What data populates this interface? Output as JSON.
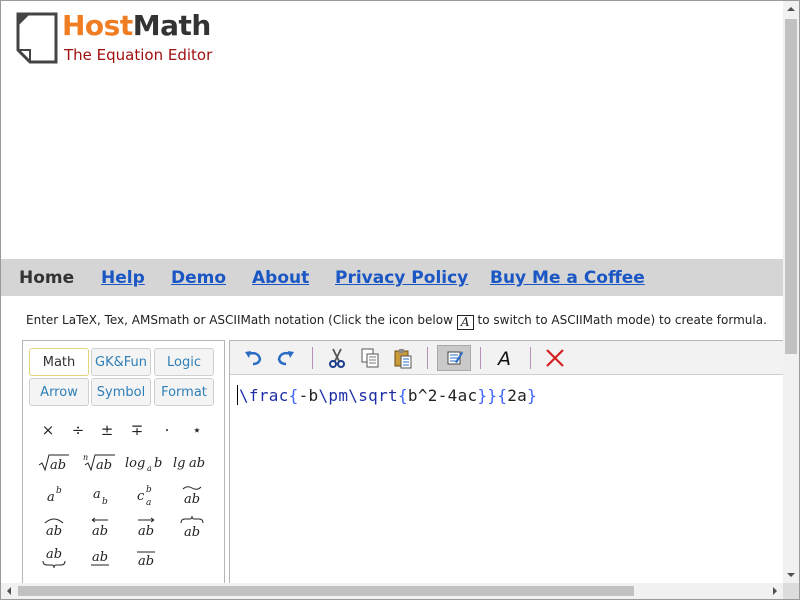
{
  "header": {
    "brand_part1": "Host",
    "brand_part2": "Math",
    "tagline": "The Equation Editor"
  },
  "nav": {
    "items": [
      "Home",
      "Help",
      "Demo",
      "About",
      "Privacy Policy",
      "Buy Me a Coffee"
    ]
  },
  "instructions": {
    "before": "Enter LaTeX, Tex, AMSmath or ASCIIMath notation (Click the icon below ",
    "icon": "A",
    "after": " to switch to ASCIIMath mode) to create formula."
  },
  "symbol_panel": {
    "tabs": [
      "Math",
      "GK&Fun",
      "Logic",
      "Arrow",
      "Symbol",
      "Format"
    ],
    "active_tab": "Math"
  },
  "toolbar": {
    "buttons": [
      "undo-icon",
      "redo-icon",
      "cut-icon",
      "copy-icon",
      "paste-icon",
      "edit-mode-icon",
      "asciimath-font-icon",
      "clear-icon"
    ]
  },
  "editor": {
    "code_parts": [
      {
        "t": "\\frac",
        "k": "cmd"
      },
      {
        "t": "{",
        "k": "br"
      },
      {
        "t": "-b",
        "k": "txt"
      },
      {
        "t": "\\pm",
        "k": "cmd"
      },
      {
        "t": "\\sqrt",
        "k": "cmd"
      },
      {
        "t": "{",
        "k": "br"
      },
      {
        "t": "b^2-4ac",
        "k": "txt"
      },
      {
        "t": "}",
        "k": "br"
      },
      {
        "t": "}",
        "k": "br"
      },
      {
        "t": "{",
        "k": "br"
      },
      {
        "t": "2a",
        "k": "txt"
      },
      {
        "t": "}",
        "k": "br"
      }
    ]
  },
  "colors": {
    "brand_orange": "#f07d22",
    "tagline_red": "#a01010",
    "nav_link": "#1a56c4",
    "nav_bg": "#d5d5d5"
  }
}
